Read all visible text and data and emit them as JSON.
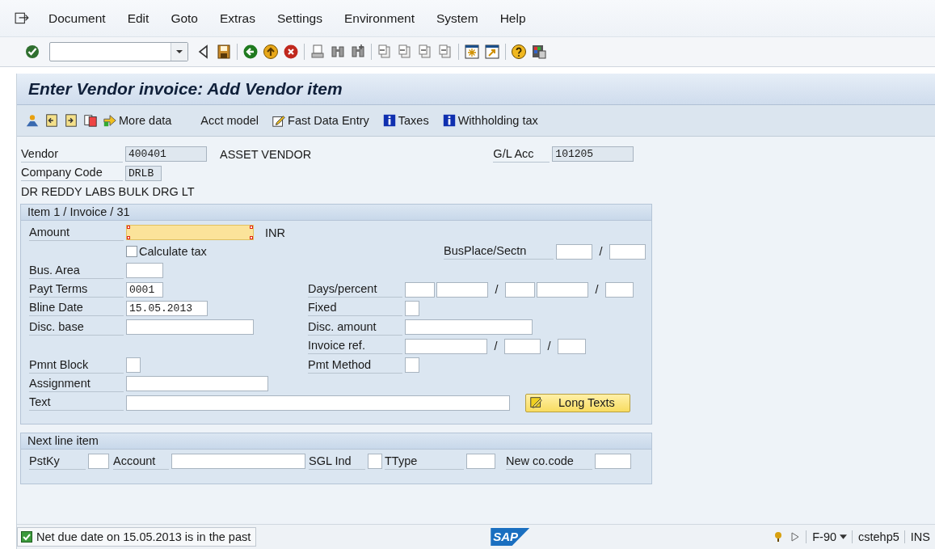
{
  "menu": [
    {
      "label": "Document"
    },
    {
      "label": "Edit"
    },
    {
      "label": "Goto"
    },
    {
      "label": "Extras"
    },
    {
      "label": "Settings"
    },
    {
      "label": "Environment"
    },
    {
      "label": "System"
    },
    {
      "label": "Help"
    }
  ],
  "title": "Enter Vendor invoice: Add Vendor item",
  "app_toolbar": [
    {
      "label": "More data",
      "kind": "arrow"
    },
    {
      "label": "Acct model",
      "kind": "plain"
    },
    {
      "label": "Fast Data Entry",
      "kind": "pencil"
    },
    {
      "label": "Taxes",
      "kind": "info"
    },
    {
      "label": "Withholding tax",
      "kind": "info"
    }
  ],
  "header": {
    "vendor_label": "Vendor",
    "vendor": "400401",
    "vendor_name": "ASSET VENDOR",
    "gl_label": "G/L Acc",
    "gl_account": "101205",
    "company_code_label": "Company Code",
    "company_code": "DRLB",
    "company_name": "DR REDDY LABS BULK DRG LT"
  },
  "item": {
    "title": "Item 1 / Invoice / 31",
    "amount": {
      "label": "Amount",
      "currency": "INR",
      "focused": true
    },
    "calculate_tax": {
      "label": "Calculate tax",
      "checked": false
    },
    "busplace": {
      "label": "BusPlace/Sectn",
      "separator": "/"
    },
    "bus_area": {
      "label": "Bus. Area"
    },
    "payt_terms": {
      "label": "Payt Terms",
      "value": "0001"
    },
    "days_percent": {
      "label": "Days/percent",
      "separators": [
        "/",
        "/"
      ]
    },
    "bline_date": {
      "label": "Bline Date",
      "value": "15.05.2013"
    },
    "fixed": {
      "label": "Fixed"
    },
    "disc_base": {
      "label": "Disc. base"
    },
    "disc_amount": {
      "label": "Disc. amount"
    },
    "invoice_ref": {
      "label": "Invoice ref.",
      "separators": [
        "/",
        "/"
      ]
    },
    "pmnt_block": {
      "label": "Pmnt Block"
    },
    "pmt_method": {
      "label": "Pmt Method"
    },
    "assignment": {
      "label": "Assignment"
    },
    "text": {
      "label": "Text"
    },
    "long_texts": "Long Texts"
  },
  "next_item": {
    "title": "Next line item",
    "pstky": "PstKy",
    "account": "Account",
    "sgl_ind": "SGL Ind",
    "ttype": "TType",
    "new_co_code": "New co.code"
  },
  "status_bar": {
    "logo": "SAP",
    "kind": "success",
    "message": "Net due date on 15.05.2013 is in the past",
    "transaction": "F-90",
    "server": "cstehp5",
    "mode": "INS"
  }
}
